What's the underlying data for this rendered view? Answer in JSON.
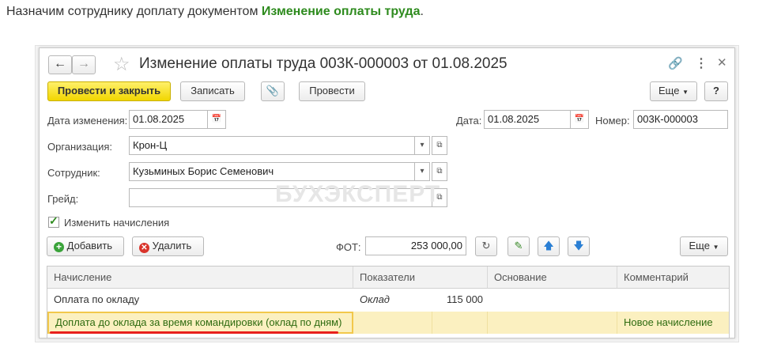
{
  "intro": {
    "prefix": "Назначим сотруднику доплату документом ",
    "doc_name": "Изменение оплаты труда",
    "suffix": "."
  },
  "window": {
    "title": "Изменение оплаты труда 003К-000003 от 01.08.2025"
  },
  "toolbar": {
    "post_close": "Провести и закрыть",
    "save": "Записать",
    "post": "Провести",
    "more": "Еще",
    "help": "?"
  },
  "form": {
    "change_date_label": "Дата изменения:",
    "change_date_value": "01.08.2025",
    "date_label": "Дата:",
    "date_value": "01.08.2025",
    "number_label": "Номер:",
    "number_value": "003К-000003",
    "org_label": "Организация:",
    "org_value": "Крон-Ц",
    "employee_label": "Сотрудник:",
    "employee_value": "Кузьминых Борис Семенович",
    "grade_label": "Грейд:",
    "grade_value": "",
    "change_accruals_label": "Изменить начисления",
    "change_accruals_checked": true
  },
  "table_toolbar": {
    "add": "Добавить",
    "delete": "Удалить",
    "fot_label": "ФОТ:",
    "fot_value": "253 000,00",
    "more": "Еще"
  },
  "table": {
    "headers": [
      "Начисление",
      "Показатели",
      "Основание",
      "Комментарий"
    ],
    "rows": [
      {
        "accrual": "Оплата по окладу",
        "indicator": "Оклад",
        "indicator_value": "115 000",
        "basis": "",
        "comment": ""
      },
      {
        "accrual": "Доплата до оклада за время командировки (оклад по дням)",
        "indicator": "",
        "indicator_value": "",
        "basis": "",
        "comment": "Новое начисление"
      }
    ]
  },
  "watermark": "БУХЭКСПЕРТ",
  "colors": {
    "accent_green": "#2e8b1e",
    "primary_yellow": "#f1d600",
    "selected_row": "#fbf0c0",
    "underline_red": "#e8201c"
  }
}
